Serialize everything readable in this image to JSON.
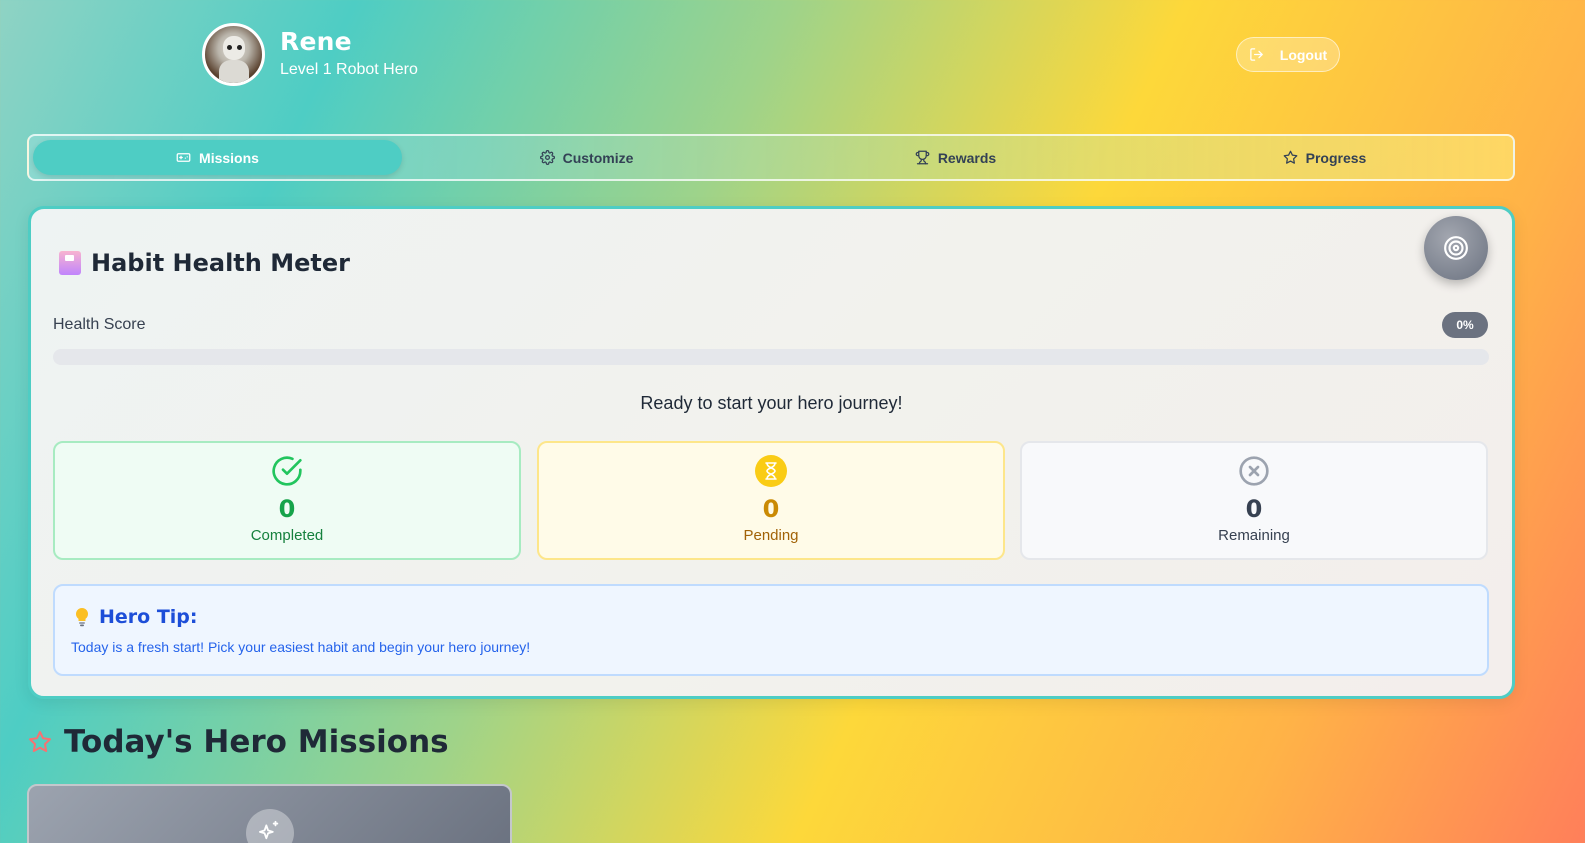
{
  "header": {
    "user_name": "Rene",
    "user_level": "Level 1 Robot Hero",
    "logout_label": "Logout"
  },
  "tabs": [
    {
      "label": "Missions",
      "icon": "gamepad-icon",
      "active": true
    },
    {
      "label": "Customize",
      "icon": "gear-icon",
      "active": false
    },
    {
      "label": "Rewards",
      "icon": "trophy-icon",
      "active": false
    },
    {
      "label": "Progress",
      "icon": "star-icon",
      "active": false
    }
  ],
  "health_meter": {
    "title": "Habit Health Meter",
    "score_label": "Health Score",
    "score_value": "0%",
    "score_fraction": 0,
    "status_message": "Ready to start your hero journey!",
    "stats": {
      "completed": {
        "value": "0",
        "label": "Completed"
      },
      "pending": {
        "value": "0",
        "label": "Pending"
      },
      "remaining": {
        "value": "0",
        "label": "Remaining"
      }
    },
    "tip": {
      "title": "Hero Tip:",
      "text": "Today is a fresh start! Pick your easiest habit and begin your hero journey!"
    }
  },
  "missions": {
    "title": "Today's Hero Missions"
  },
  "colors": {
    "accent": "#4ecdc4",
    "completed": "#16a34a",
    "pending": "#ca8a04",
    "tip": "#1d4ed8"
  }
}
